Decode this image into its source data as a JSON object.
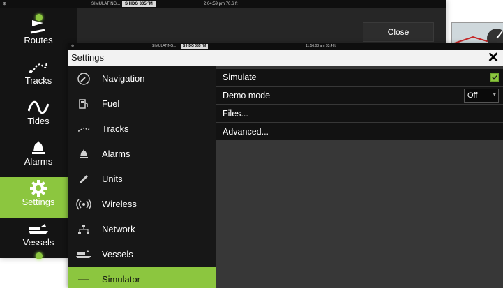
{
  "back": {
    "statusbar": {
      "simulating": "SIMULATING...",
      "heading": "S HDG 305 °M",
      "time": "2:04:59 pm 70.6 ft"
    },
    "sidebar": [
      {
        "label": "Routes",
        "icon": "route-flag-icon"
      },
      {
        "label": "Tracks",
        "icon": "track-icon"
      },
      {
        "label": "Tides",
        "icon": "tide-wave-icon"
      },
      {
        "label": "Alarms",
        "icon": "alarm-bell-icon"
      },
      {
        "label": "Settings",
        "icon": "gear-icon",
        "selected": true
      },
      {
        "label": "Vessels",
        "icon": "vessel-icon"
      }
    ],
    "close_label": "Close"
  },
  "settings": {
    "statusbar": {
      "simulating": "SIMULATING...",
      "heading": "S HDG 055 °M",
      "time": "11:56:08 am 83.4 ft"
    },
    "title": "Settings",
    "close_symbol": "✕",
    "menu": [
      {
        "label": "Navigation",
        "icon": "compass-icon"
      },
      {
        "label": "Fuel",
        "icon": "fuel-pump-icon"
      },
      {
        "label": "Tracks",
        "icon": "track-icon"
      },
      {
        "label": "Alarms",
        "icon": "alarm-bell-icon"
      },
      {
        "label": "Units",
        "icon": "ruler-icon"
      },
      {
        "label": "Wireless",
        "icon": "wireless-icon"
      },
      {
        "label": "Network",
        "icon": "network-icon"
      },
      {
        "label": "Vessels",
        "icon": "vessel-icon"
      },
      {
        "label": "Simulator",
        "icon": "simulator-icon",
        "selected": true
      }
    ],
    "options": {
      "simulate": {
        "label": "Simulate",
        "checked": true
      },
      "demo_mode": {
        "label": "Demo mode",
        "value": "Off"
      },
      "files": {
        "label": "Files..."
      },
      "advanced": {
        "label": "Advanced..."
      }
    }
  },
  "colors": {
    "accent": "#8cc63f",
    "menu_bg": "#171717",
    "panel_bg": "#373737",
    "title_bg": "#f2f2f2"
  }
}
